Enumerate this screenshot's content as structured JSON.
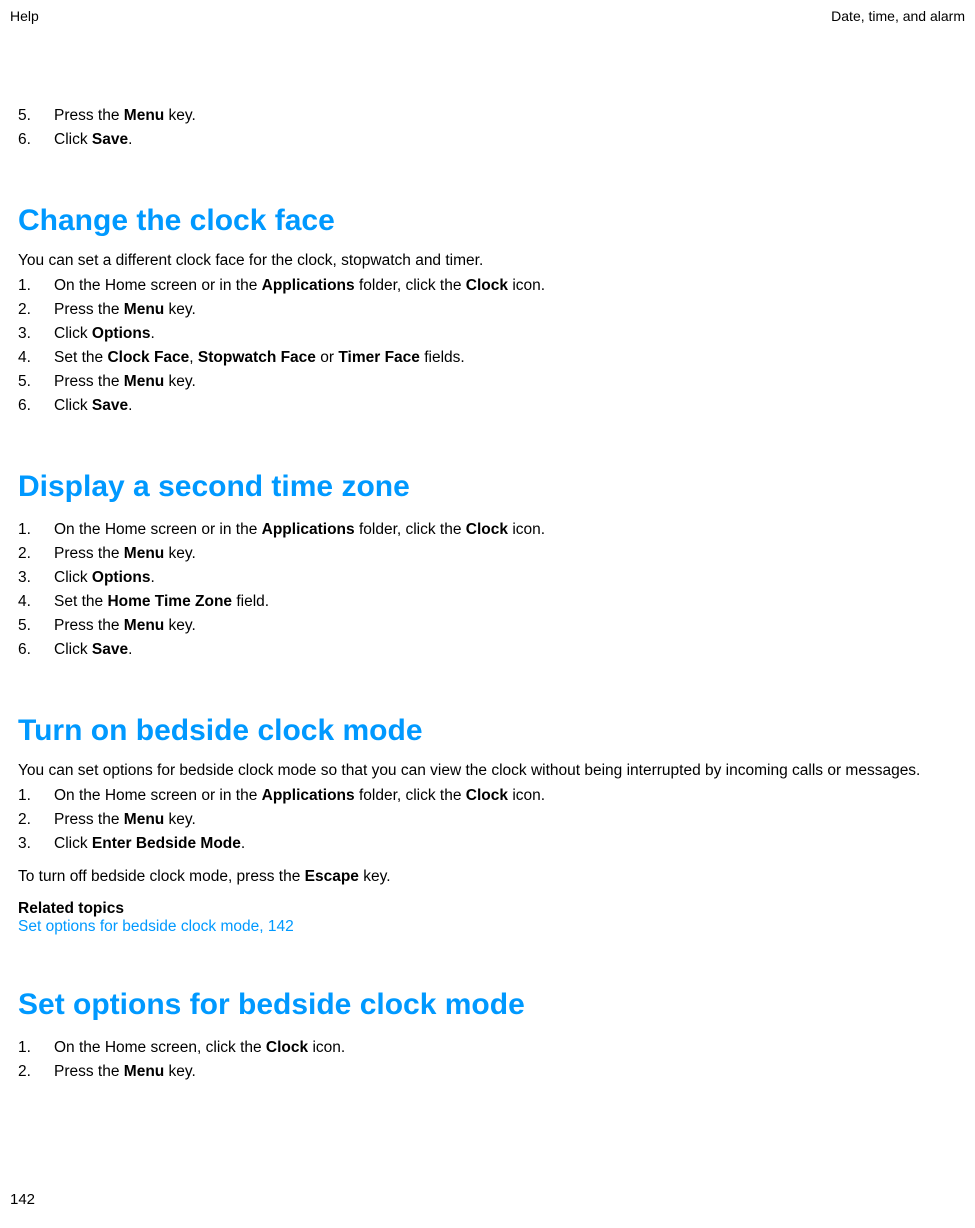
{
  "header": {
    "left": "Help",
    "right": "Date, time, and alarm"
  },
  "intro_steps": {
    "items": [
      {
        "num": "5.",
        "text_before": "Press the ",
        "bold1": "Menu",
        "text_after": " key."
      },
      {
        "num": "6.",
        "text_before": "Click ",
        "bold1": "Save",
        "text_after": "."
      }
    ]
  },
  "section1": {
    "heading": "Change the clock face",
    "intro": "You can set a different clock face for the clock, stopwatch and timer.",
    "items": [
      {
        "num": "1.",
        "parts": [
          {
            "t": "On the Home screen or in the "
          },
          {
            "b": "Applications"
          },
          {
            "t": " folder, click the "
          },
          {
            "b": "Clock"
          },
          {
            "t": " icon."
          }
        ]
      },
      {
        "num": "2.",
        "parts": [
          {
            "t": "Press the "
          },
          {
            "b": "Menu"
          },
          {
            "t": " key."
          }
        ]
      },
      {
        "num": "3.",
        "parts": [
          {
            "t": "Click "
          },
          {
            "b": "Options"
          },
          {
            "t": "."
          }
        ]
      },
      {
        "num": "4.",
        "parts": [
          {
            "t": "Set the "
          },
          {
            "b": "Clock Face"
          },
          {
            "t": ", "
          },
          {
            "b": "Stopwatch Face"
          },
          {
            "t": " or "
          },
          {
            "b": "Timer Face"
          },
          {
            "t": " fields."
          }
        ]
      },
      {
        "num": "5.",
        "parts": [
          {
            "t": "Press the "
          },
          {
            "b": "Menu"
          },
          {
            "t": " key."
          }
        ]
      },
      {
        "num": "6.",
        "parts": [
          {
            "t": "Click "
          },
          {
            "b": "Save"
          },
          {
            "t": "."
          }
        ]
      }
    ]
  },
  "section2": {
    "heading": "Display a second time zone",
    "items": [
      {
        "num": "1.",
        "parts": [
          {
            "t": "On the Home screen or in the "
          },
          {
            "b": "Applications"
          },
          {
            "t": " folder, click the "
          },
          {
            "b": "Clock"
          },
          {
            "t": " icon."
          }
        ]
      },
      {
        "num": "2.",
        "parts": [
          {
            "t": "Press the "
          },
          {
            "b": "Menu"
          },
          {
            "t": " key."
          }
        ]
      },
      {
        "num": "3.",
        "parts": [
          {
            "t": "Click "
          },
          {
            "b": "Options"
          },
          {
            "t": "."
          }
        ]
      },
      {
        "num": "4.",
        "parts": [
          {
            "t": "Set the "
          },
          {
            "b": "Home Time Zone"
          },
          {
            "t": " field."
          }
        ]
      },
      {
        "num": "5.",
        "parts": [
          {
            "t": "Press the "
          },
          {
            "b": "Menu"
          },
          {
            "t": " key."
          }
        ]
      },
      {
        "num": "6.",
        "parts": [
          {
            "t": "Click "
          },
          {
            "b": "Save"
          },
          {
            "t": "."
          }
        ]
      }
    ]
  },
  "section3": {
    "heading": "Turn on bedside clock mode",
    "intro": "You can set options for bedside clock mode so that you can view the clock without being interrupted by incoming calls or messages.",
    "items": [
      {
        "num": "1.",
        "parts": [
          {
            "t": "On the Home screen or in the "
          },
          {
            "b": "Applications"
          },
          {
            "t": " folder, click the "
          },
          {
            "b": "Clock"
          },
          {
            "t": " icon."
          }
        ]
      },
      {
        "num": "2.",
        "parts": [
          {
            "t": "Press the "
          },
          {
            "b": "Menu"
          },
          {
            "t": " key."
          }
        ]
      },
      {
        "num": "3.",
        "parts": [
          {
            "t": "Click "
          },
          {
            "b": "Enter Bedside Mode"
          },
          {
            "t": "."
          }
        ]
      }
    ],
    "after_parts": [
      {
        "t": "To turn off bedside clock mode, press the "
      },
      {
        "b": "Escape"
      },
      {
        "t": " key."
      }
    ],
    "related_heading": "Related topics",
    "related_link": "Set options for bedside clock mode, 142"
  },
  "section4": {
    "heading": "Set options for bedside clock mode",
    "items": [
      {
        "num": "1.",
        "parts": [
          {
            "t": "On the Home screen, click the "
          },
          {
            "b": "Clock"
          },
          {
            "t": " icon."
          }
        ]
      },
      {
        "num": "2.",
        "parts": [
          {
            "t": "Press the "
          },
          {
            "b": "Menu"
          },
          {
            "t": " key."
          }
        ]
      }
    ]
  },
  "page_number": "142"
}
